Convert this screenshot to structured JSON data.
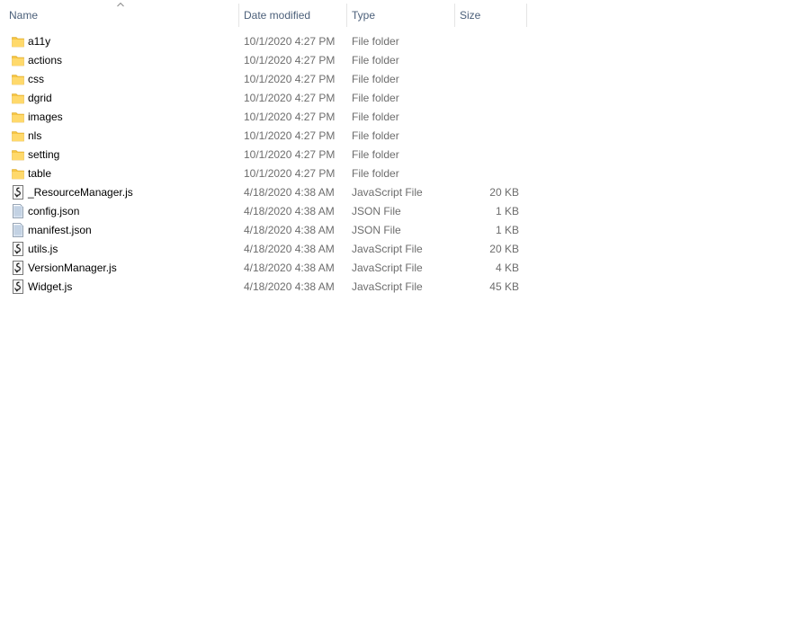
{
  "columns": {
    "name": "Name",
    "date_modified": "Date modified",
    "type": "Type",
    "size": "Size"
  },
  "sort": {
    "column": "name",
    "direction": "ascending"
  },
  "items": [
    {
      "name": "a11y",
      "date": "10/1/2020 4:27 PM",
      "type": "File folder",
      "size": "",
      "icon": "folder-icon"
    },
    {
      "name": "actions",
      "date": "10/1/2020 4:27 PM",
      "type": "File folder",
      "size": "",
      "icon": "folder-icon"
    },
    {
      "name": "css",
      "date": "10/1/2020 4:27 PM",
      "type": "File folder",
      "size": "",
      "icon": "folder-icon"
    },
    {
      "name": "dgrid",
      "date": "10/1/2020 4:27 PM",
      "type": "File folder",
      "size": "",
      "icon": "folder-icon"
    },
    {
      "name": "images",
      "date": "10/1/2020 4:27 PM",
      "type": "File folder",
      "size": "",
      "icon": "folder-icon"
    },
    {
      "name": "nls",
      "date": "10/1/2020 4:27 PM",
      "type": "File folder",
      "size": "",
      "icon": "folder-icon"
    },
    {
      "name": "setting",
      "date": "10/1/2020 4:27 PM",
      "type": "File folder",
      "size": "",
      "icon": "folder-icon"
    },
    {
      "name": "table",
      "date": "10/1/2020 4:27 PM",
      "type": "File folder",
      "size": "",
      "icon": "folder-icon"
    },
    {
      "name": "_ResourceManager.js",
      "date": "4/18/2020 4:38 AM",
      "type": "JavaScript File",
      "size": "20 KB",
      "icon": "javascript-file-icon"
    },
    {
      "name": "config.json",
      "date": "4/18/2020 4:38 AM",
      "type": "JSON File",
      "size": "1 KB",
      "icon": "json-file-icon"
    },
    {
      "name": "manifest.json",
      "date": "4/18/2020 4:38 AM",
      "type": "JSON File",
      "size": "1 KB",
      "icon": "json-file-icon"
    },
    {
      "name": "utils.js",
      "date": "4/18/2020 4:38 AM",
      "type": "JavaScript File",
      "size": "20 KB",
      "icon": "javascript-file-icon"
    },
    {
      "name": "VersionManager.js",
      "date": "4/18/2020 4:38 AM",
      "type": "JavaScript File",
      "size": "4 KB",
      "icon": "javascript-file-icon"
    },
    {
      "name": "Widget.js",
      "date": "4/18/2020 4:38 AM",
      "type": "JavaScript File",
      "size": "45 KB",
      "icon": "javascript-file-icon"
    }
  ],
  "colors": {
    "header_text": "#4c607a",
    "secondary_text": "#6d6d6d",
    "folder": "#ffd75e",
    "folder_dark": "#e8b84a"
  }
}
